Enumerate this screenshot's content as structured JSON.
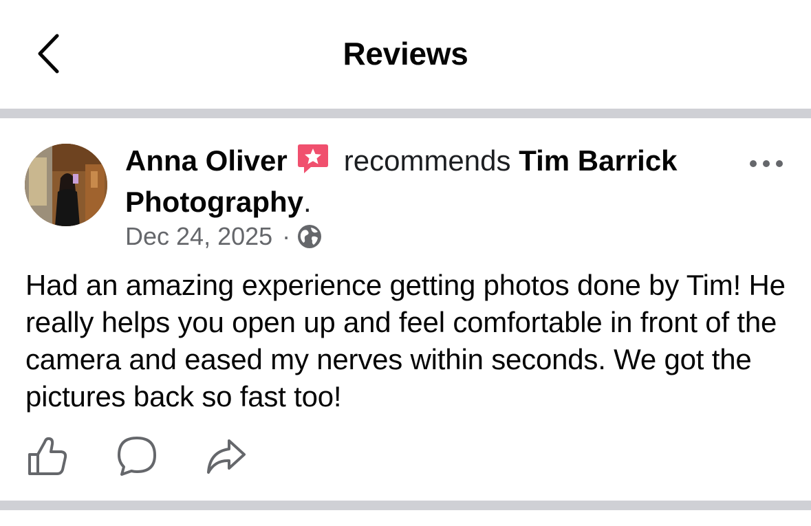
{
  "header": {
    "title": "Reviews",
    "back_icon": "chevron-left-icon"
  },
  "review": {
    "author": "Anna Oliver",
    "badge_icon": "recommend-star-icon",
    "badge_color": "#f0506e",
    "verb": "recommends",
    "page_name": "Tim Barrick Photography",
    "period": ".",
    "date": "Dec 24, 2025",
    "separator": "·",
    "privacy_icon": "globe-icon",
    "more_icon": "more-horizontal-icon",
    "text": "Had an amazing experience getting photos done by Tim! He really helps you open up and feel comfortable in front of the camera and eased my nerves within seconds. We got the pictures back so fast too!",
    "actions": [
      "thumbs-up-icon",
      "comment-icon",
      "share-icon"
    ]
  },
  "colors": {
    "text_primary": "#050505",
    "text_secondary": "#65676b",
    "divider": "#cfd0d5",
    "background": "#ffffff"
  }
}
